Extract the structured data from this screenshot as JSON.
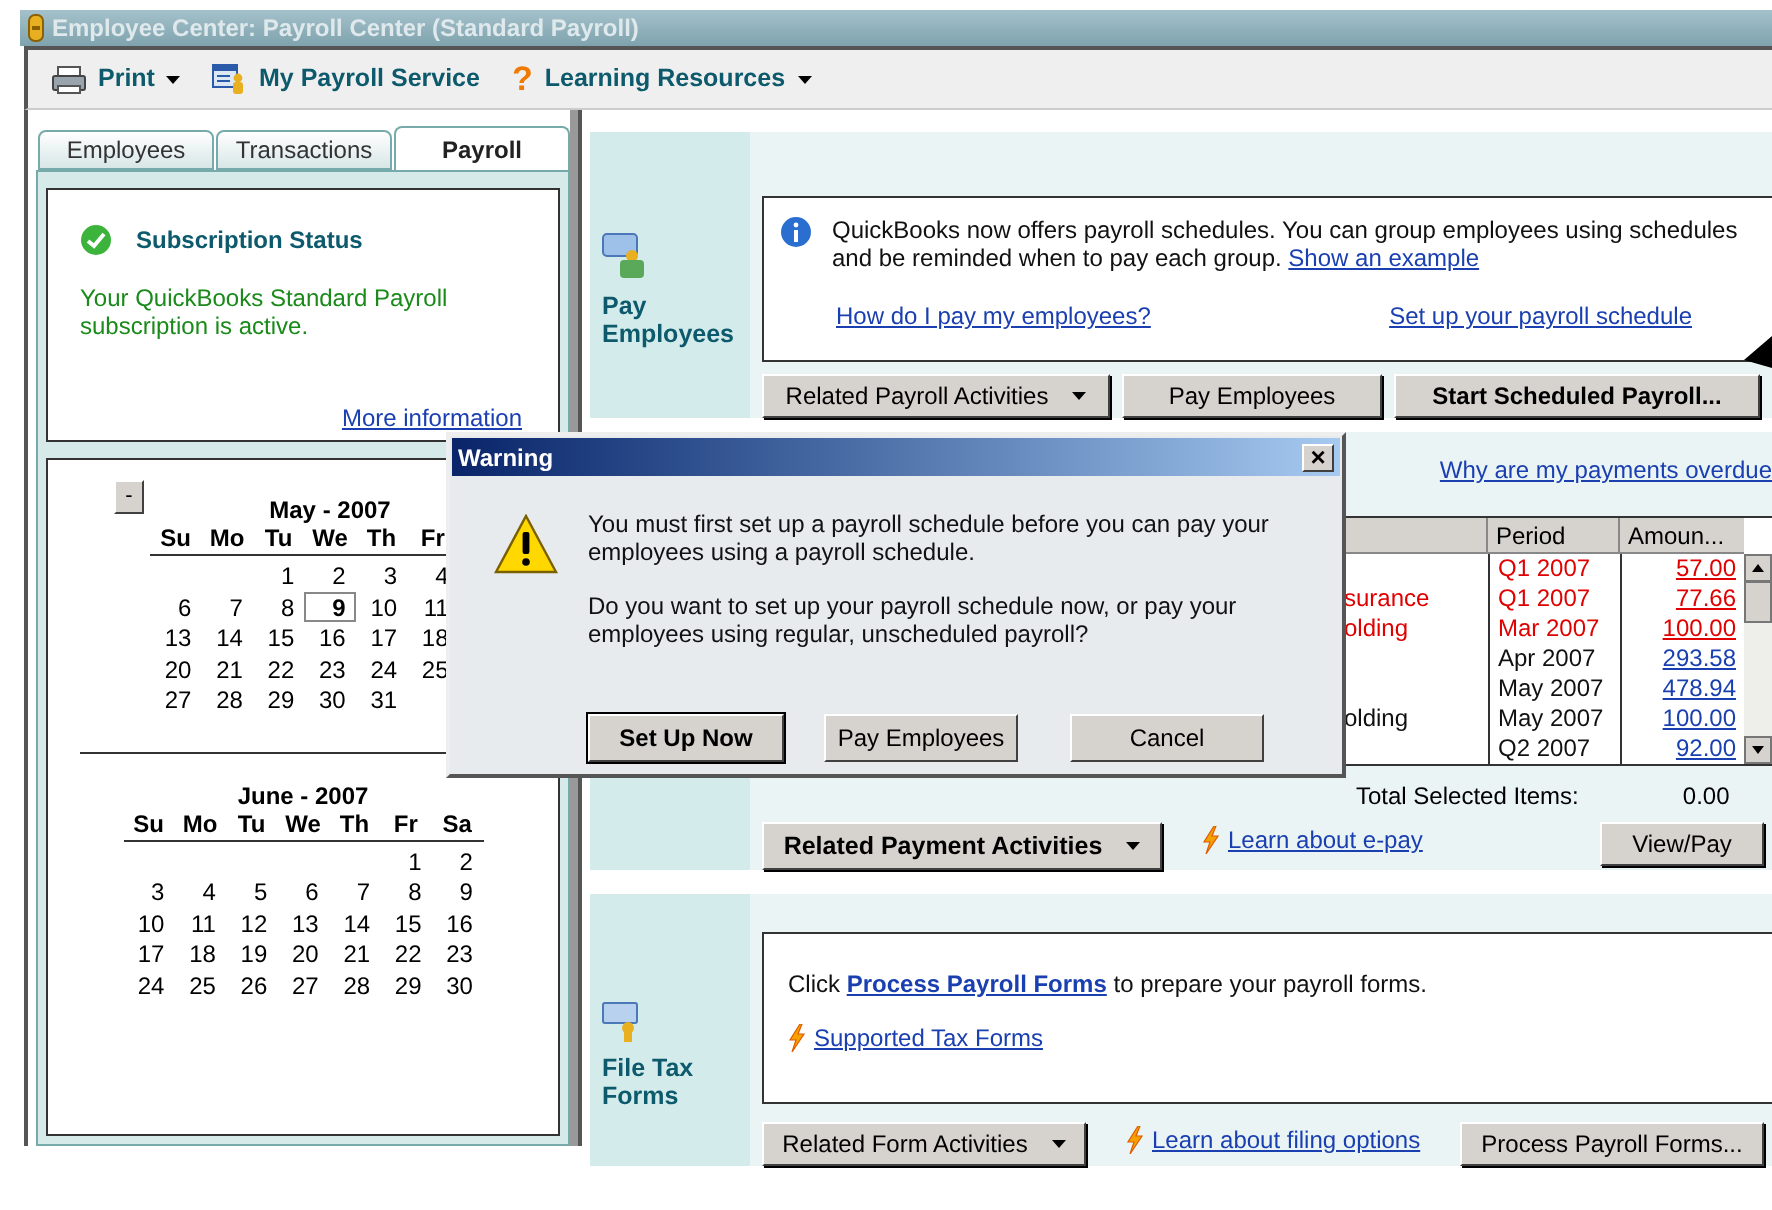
{
  "window": {
    "title": "Employee Center: Payroll Center (Standard Payroll)"
  },
  "toolbar": [
    {
      "label": "Print",
      "kind": "print",
      "menu": true
    },
    {
      "label": "My Payroll Service",
      "kind": "service",
      "menu": false
    },
    {
      "label": "Learning Resources",
      "kind": "help",
      "icon": "?",
      "menu": true
    }
  ],
  "tabs": [
    {
      "label": "Employees",
      "selected": false
    },
    {
      "label": "Transactions",
      "selected": false
    },
    {
      "label": "Payroll",
      "selected": true
    }
  ],
  "subscription": {
    "title": "Subscription Status",
    "message": "Your QuickBooks Standard Payroll subscription is active.",
    "link": "More information"
  },
  "calendar": {
    "collapse": "-",
    "months": [
      {
        "title": "May - 2007",
        "weekdays": [
          "Su",
          "Mo",
          "Tu",
          "We",
          "Th",
          "Fr"
        ],
        "weeks": [
          [
            {
              "d": "1",
              "selected": false
            },
            {
              "d": "2",
              "selected": false
            },
            {
              "d": "3",
              "selected": false
            },
            {
              "d": "4",
              "selected": false
            }
          ],
          [
            {
              "d": "6",
              "selected": false
            },
            {
              "d": "7",
              "selected": false
            },
            {
              "d": "8",
              "selected": false
            },
            {
              "d": "9",
              "selected": true
            },
            {
              "d": "10",
              "selected": false
            },
            {
              "d": "11",
              "selected": false
            }
          ],
          [
            {
              "d": "13",
              "selected": false
            },
            {
              "d": "14",
              "selected": false
            },
            {
              "d": "15",
              "selected": false
            },
            {
              "d": "16",
              "selected": false
            },
            {
              "d": "17",
              "selected": false
            },
            {
              "d": "18",
              "selected": false
            }
          ],
          [
            {
              "d": "20",
              "selected": false
            },
            {
              "d": "21",
              "selected": false
            },
            {
              "d": "22",
              "selected": false
            },
            {
              "d": "23",
              "selected": false
            },
            {
              "d": "24",
              "selected": false
            },
            {
              "d": "25",
              "selected": false
            }
          ],
          [
            {
              "d": "27",
              "selected": false
            },
            {
              "d": "28",
              "selected": false
            },
            {
              "d": "29",
              "selected": false
            },
            {
              "d": "30",
              "selected": false
            },
            {
              "d": "31",
              "selected": false
            }
          ]
        ]
      },
      {
        "title": "June - 2007",
        "weekdays": [
          "Su",
          "Mo",
          "Tu",
          "We",
          "Th",
          "Fr",
          "Sa"
        ],
        "weeks": [
          [
            {
              "d": "1",
              "selected": false
            },
            {
              "d": "2",
              "selected": false
            }
          ],
          [
            {
              "d": "3",
              "selected": false
            },
            {
              "d": "4",
              "selected": false
            },
            {
              "d": "5",
              "selected": false
            },
            {
              "d": "6",
              "selected": false
            },
            {
              "d": "7",
              "selected": false
            },
            {
              "d": "8",
              "selected": false
            },
            {
              "d": "9",
              "selected": false
            }
          ],
          [
            {
              "d": "10",
              "selected": false
            },
            {
              "d": "11",
              "selected": false
            },
            {
              "d": "12",
              "selected": false
            },
            {
              "d": "13",
              "selected": false
            },
            {
              "d": "14",
              "selected": false
            },
            {
              "d": "15",
              "selected": false
            },
            {
              "d": "16",
              "selected": false
            }
          ],
          [
            {
              "d": "17",
              "selected": false
            },
            {
              "d": "18",
              "selected": false
            },
            {
              "d": "19",
              "selected": false
            },
            {
              "d": "20",
              "selected": false
            },
            {
              "d": "21",
              "selected": false
            },
            {
              "d": "22",
              "selected": false
            },
            {
              "d": "23",
              "selected": false
            }
          ],
          [
            {
              "d": "24",
              "selected": false
            },
            {
              "d": "25",
              "selected": false
            },
            {
              "d": "26",
              "selected": false
            },
            {
              "d": "27",
              "selected": false
            },
            {
              "d": "28",
              "selected": false
            },
            {
              "d": "29",
              "selected": false
            },
            {
              "d": "30",
              "selected": false
            }
          ]
        ]
      }
    ]
  },
  "pay_employees": {
    "label": "Pay Employees",
    "info": "QuickBooks now offers payroll schedules. You can group employees using schedules and be reminded when to pay each group.",
    "info_link": "Show an example",
    "links": [
      "How do I pay my employees?",
      "Set up your payroll schedule"
    ],
    "buttons": [
      {
        "label": "Related Payroll Activities",
        "kind": "menu"
      },
      {
        "label": "Pay Employees",
        "kind": "plain"
      },
      {
        "label": "Start Scheduled Payroll...",
        "kind": "primary"
      }
    ]
  },
  "liabilities": {
    "link": "Why are my payments overdue",
    "columns": [
      "Period",
      "Amoun..."
    ],
    "rows": [
      {
        "period": "Q1 2007",
        "amount": "57.00",
        "overdue": true
      },
      {
        "item": "surance",
        "period": "Q1 2007",
        "amount": "77.66",
        "overdue": true
      },
      {
        "item": "olding",
        "period": "Mar 2007",
        "amount": "100.00",
        "overdue": true
      },
      {
        "period": "Apr 2007",
        "amount": "293.58",
        "overdue": false
      },
      {
        "period": "May 2007",
        "amount": "478.94",
        "overdue": false
      },
      {
        "item": "olding",
        "period": "May 2007",
        "amount": "100.00",
        "overdue": false
      },
      {
        "period": "Q2 2007",
        "amount": "92.00",
        "overdue": false
      }
    ],
    "total_label": "Total Selected Items:",
    "total": "0.00",
    "menu_button": "Related Payment Activities",
    "epay_link": "Learn about e-pay",
    "view_button": "View/Pay"
  },
  "tax_forms": {
    "label": "File Tax Forms",
    "text_before": "Click",
    "text_link": "Process Payroll Forms",
    "text_after": "to prepare your payroll forms.",
    "link": "Supported Tax Forms",
    "menu_button": "Related Form Activities",
    "filing_link": "Learn about filing options",
    "process_button": "Process Payroll Forms..."
  },
  "dialog": {
    "title": "Warning",
    "close": "×",
    "messages": [
      "You must first set up a payroll schedule before you can pay your employees using a payroll schedule.",
      "Do you want to set up your payroll schedule now, or pay your employees using regular, unscheduled payroll?"
    ],
    "buttons": [
      {
        "label": "Set Up Now",
        "default": true
      },
      {
        "label": "Pay Employees",
        "default": false
      },
      {
        "label": "Cancel",
        "default": false
      }
    ]
  }
}
